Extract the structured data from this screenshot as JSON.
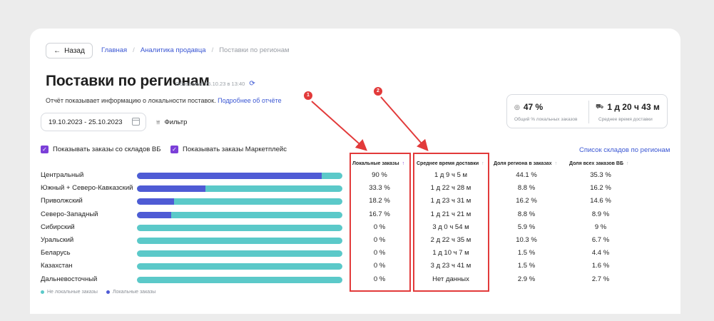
{
  "nav": {
    "back_label": "Назад",
    "breadcrumbs": [
      {
        "label": "Главная"
      },
      {
        "label": "Аналитика продавца"
      },
      {
        "label": "Поставки по регионам"
      }
    ]
  },
  "header": {
    "title": "Поставки по регионам",
    "updated": "Обновлено 25.10.23 в 13:40",
    "description": "Отчёт показывает информацию о локальности поставок.",
    "description_link": "Подробнее об отчёте"
  },
  "filters": {
    "date_range": "19.10.2023 - 25.10.2023",
    "filter_label": "Фильтр",
    "checkbox_wb": "Показывать заказы со складов ВБ",
    "checkbox_mp": "Показывать заказы Маркетплейс",
    "warehouses_link": "Список складов по регионам"
  },
  "summary": {
    "local_share_value": "47 %",
    "local_share_label": "Общий % локальных заказов",
    "avg_delivery_value": "1 д 20 ч 43 м",
    "avg_delivery_label": "Среднее время доставки"
  },
  "table": {
    "headers": {
      "local": "Локальные заказы",
      "delivery": "Среднее время доставки",
      "region_share": "Доля региона в заказах",
      "wb_share": "Доля всех заказов ВБ"
    },
    "rows": [
      {
        "region": "Центральный",
        "local": "90 %",
        "local_fraction": 0.9,
        "delivery": "1 д 9 ч 5 м",
        "region_share": "44.1 %",
        "wb_share": "35.3 %"
      },
      {
        "region": "Южный + Северо-Кавказский",
        "local": "33.3 %",
        "local_fraction": 0.333,
        "delivery": "1 д 22 ч 28 м",
        "region_share": "8.8 %",
        "wb_share": "16.2 %"
      },
      {
        "region": "Приволжский",
        "local": "18.2 %",
        "local_fraction": 0.182,
        "delivery": "1 д 23 ч 31 м",
        "region_share": "16.2 %",
        "wb_share": "14.6 %"
      },
      {
        "region": "Северо-Западный",
        "local": "16.7 %",
        "local_fraction": 0.167,
        "delivery": "1 д 21 ч 21 м",
        "region_share": "8.8 %",
        "wb_share": "8.9 %"
      },
      {
        "region": "Сибирский",
        "local": "0 %",
        "local_fraction": 0,
        "delivery": "3 д 0 ч 54 м",
        "region_share": "5.9 %",
        "wb_share": "9 %"
      },
      {
        "region": "Уральский",
        "local": "0 %",
        "local_fraction": 0,
        "delivery": "2 д 22 ч 35 м",
        "region_share": "10.3 %",
        "wb_share": "6.7 %"
      },
      {
        "region": "Беларусь",
        "local": "0 %",
        "local_fraction": 0,
        "delivery": "1 д 10 ч 7 м",
        "region_share": "1.5 %",
        "wb_share": "4.4 %"
      },
      {
        "region": "Казахстан",
        "local": "0 %",
        "local_fraction": 0,
        "delivery": "3 д 23 ч 41 м",
        "region_share": "1.5 %",
        "wb_share": "1.6 %"
      },
      {
        "region": "Дальневосточный",
        "local": "0 %",
        "local_fraction": 0,
        "delivery": "Нет данных",
        "region_share": "2.9 %",
        "wb_share": "2.7 %"
      }
    ]
  },
  "legend": {
    "non_local": "Не локальные заказы",
    "local": "Локальные заказы"
  },
  "annotations": {
    "badge1": "1",
    "badge2": "2"
  },
  "colors": {
    "accent": "#3b57d3",
    "local_bar": "#4f5bd5",
    "non_local_bar": "#5bc9c9",
    "checkbox": "#7b3fd8",
    "highlight": "#e23a3a"
  }
}
